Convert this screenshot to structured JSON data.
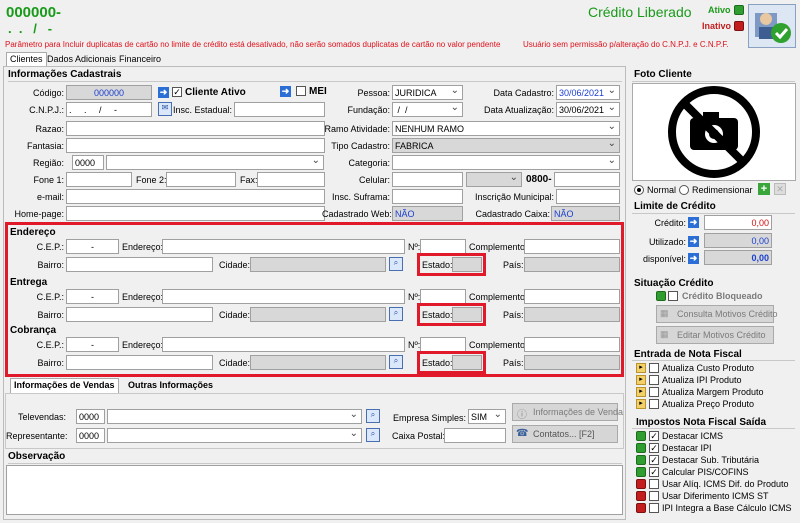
{
  "header": {
    "code": "000000-",
    "subcode": ".  .   /   -",
    "credit_status": "Crédito Liberado",
    "ativo": "Ativo",
    "inativo": "Inativo",
    "warning1": "Parâmetro para Incluir duplicatas de cartão no limite de crédito está desativado, não serão somados duplicatas de cartão no valor pendente",
    "warning2": "Usuário sem permissão p/alteração do C.N.P.J.  e C.N.P.F."
  },
  "tabs": [
    "Clientes",
    "Dados Adicionais",
    "Financeiro"
  ],
  "info": {
    "title": "Informações Cadastrais",
    "codigo_label": "Código:",
    "codigo": "000000",
    "cliente_ativo": "Cliente Ativo",
    "mei": "MEI",
    "pessoa_label": "Pessoa:",
    "pessoa": "JURIDICA",
    "data_cad_label": "Data Cadastro:",
    "data_cad": "30/06/2021",
    "cnpj_label": "C.N.P.J.:",
    "cnpj": ".     .     /     -",
    "insc_est_label": "Insc. Estadual:",
    "fundacao_label": "Fundação:",
    "fundacao": " /  /",
    "data_atual_label": "Data Atualização:",
    "data_atual": "30/06/2021",
    "razao_label": "Razao:",
    "ramo_label": "Ramo Atividade:",
    "ramo": "NENHUM RAMO",
    "fantasia_label": "Fantasia:",
    "tipo_label": "Tipo Cadastro:",
    "tipo": "FABRICA",
    "regiao_label": "Região:",
    "regiao": "0000",
    "categoria_label": "Categoria:",
    "fone1_label": "Fone 1:",
    "fone2_label": "Fone 2:",
    "fax_label": "Fax:",
    "celular_label": "Celular:",
    "prefix0800": "0800-",
    "email_label": "e-mail:",
    "suframa_label": "Insc. Suframa:",
    "insc_mun_label": "Inscrição Municipal:",
    "homepage_label": "Home-page:",
    "cad_web_label": "Cadastrado Web:",
    "cad_web": "NÃO",
    "cad_caixa_label": "Cadastrado Caixa:",
    "cad_caixa": "NÃO"
  },
  "address": {
    "cep_label": "C.E.P.:",
    "cep": "-",
    "endereco_label": "Endereço:",
    "num_label": "Nº:",
    "complemento_label": "Complemento:",
    "bairro_label": "Bairro:",
    "cidade_label": "Cidade:",
    "estado_label": "Estado:",
    "pais_label": "País:",
    "sections": [
      "Endereço",
      "Entrega",
      "Cobrança"
    ]
  },
  "vendas": {
    "tab1": "Informações de Vendas",
    "tab2": "Outras Informações",
    "televendas_label": "Televendas:",
    "televendas": "0000",
    "representante_label": "Representante:",
    "representante": "0000",
    "empresa_simples_label": "Empresa Simples:",
    "empresa_simples": "SIM",
    "caixa_postal_label": "Caixa Postal:",
    "info_vendas_btn": "Informações de Venda",
    "contatos_btn": "Contatos... [F2]"
  },
  "obs": {
    "title": "Observação"
  },
  "foto": {
    "title": "Foto Cliente",
    "normal": "Normal",
    "redimensionar": "Redimensionar"
  },
  "limite": {
    "title": "Limite de Crédito",
    "credito_label": "Crédito:",
    "credito": "0,00",
    "utilizado_label": "Utilizado:",
    "utilizado": "0,00",
    "disponivel_label": "disponível:",
    "disponivel": "0,00"
  },
  "situacao": {
    "title": "Situação Crédito",
    "bloqueado": "Crédito Bloqueado",
    "consulta_btn": "Consulta Motivos Crédito",
    "editar_btn": "Editar Motivos Crédito"
  },
  "nota": {
    "title": "Entrada de Nota Fiscal",
    "items": [
      "Atualiza Custo Produto",
      "Atualiza IPI Produto",
      "Atualiza Margem Produto",
      "Atualiza Preço Produto"
    ]
  },
  "impostos": {
    "title": "Impostos Nota Fiscal Saída",
    "items": [
      {
        "label": "Destacar ICMS",
        "led": "green",
        "checked": true
      },
      {
        "label": "Destacar IPI",
        "led": "green",
        "checked": true
      },
      {
        "label": "Destacar Sub. Tributária",
        "led": "green",
        "checked": true
      },
      {
        "label": "Calcular PIS/COFINS",
        "led": "green",
        "checked": true
      },
      {
        "label": "Usar Alíq. ICMS Dif. do Produto",
        "led": "red",
        "checked": false
      },
      {
        "label": "Usar Diferimento ICMS ST",
        "led": "red",
        "checked": false
      },
      {
        "label": "IPI Integra a Base Cálculo ICMS",
        "led": "red",
        "checked": false
      }
    ]
  }
}
